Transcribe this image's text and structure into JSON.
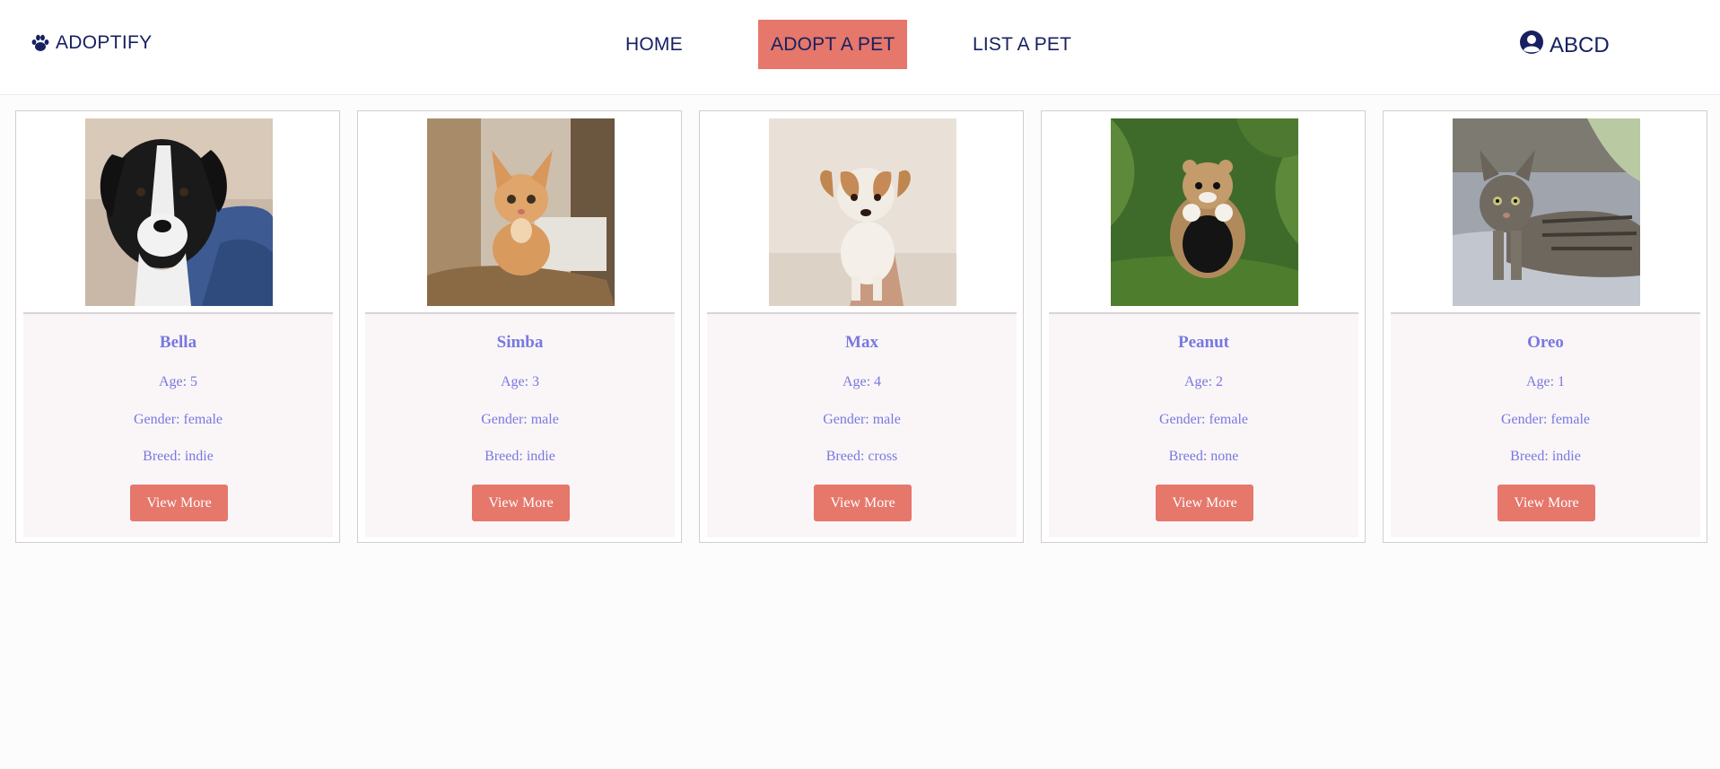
{
  "app": {
    "brand": "ADOPTIFY",
    "user_name": "ABCD"
  },
  "nav": {
    "home": "HOME",
    "adopt": "ADOPT A PET",
    "list": "LIST A PET"
  },
  "colors": {
    "accent": "#e5776b",
    "navy": "#172060",
    "pet_text": "#7878e0"
  },
  "pets": [
    {
      "name": "Bella",
      "age": "Age: 5",
      "gender": "Gender: female",
      "breed": "Breed: indie",
      "button": "View More"
    },
    {
      "name": "Simba",
      "age": "Age: 3",
      "gender": "Gender: male",
      "breed": "Breed: indie",
      "button": "View More"
    },
    {
      "name": "Max",
      "age": "Age: 4",
      "gender": "Gender: male",
      "breed": "Breed: cross",
      "button": "View More"
    },
    {
      "name": "Peanut",
      "age": "Age: 2",
      "gender": "Gender: female",
      "breed": "Breed: none",
      "button": "View More"
    },
    {
      "name": "Oreo",
      "age": "Age: 1",
      "gender": "Gender: female",
      "breed": "Breed: indie",
      "button": "View More"
    }
  ]
}
